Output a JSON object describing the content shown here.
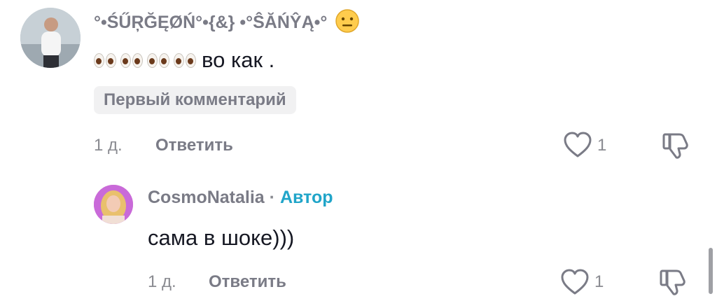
{
  "comments": [
    {
      "username": "°•ŚŰŖĞĘØŃ°•{&} •°ŜĂŃŶĄ•°",
      "text": "во как .",
      "badge": "Первый комментарий",
      "time": "1 д.",
      "reply_label": "Ответить",
      "likes": "1"
    },
    {
      "username": "CosmoNatalia",
      "separator": "·",
      "author_tag": "Автор",
      "text": "сама в шоке)))",
      "time": "1 д.",
      "reply_label": "Ответить",
      "likes": "1"
    }
  ],
  "icons": {
    "like": "heart-outline-icon",
    "dislike": "thumbs-down-outline-icon",
    "emoji_neutral": "neutral-face-emoji-icon",
    "eyes_emoji": "eyes-emoji-icon"
  },
  "colors": {
    "author_tag": "#20a5c9",
    "muted_text": "#7a7b86",
    "primary_text": "#161823",
    "badge_bg": "#f1f1f2"
  }
}
